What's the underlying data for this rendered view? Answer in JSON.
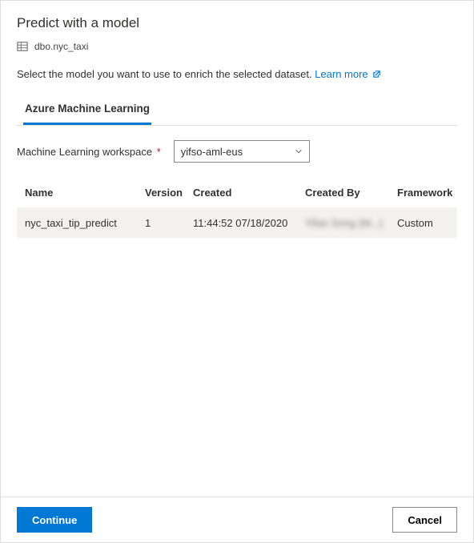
{
  "header": {
    "title": "Predict with a model",
    "dataset_name": "dbo.nyc_taxi"
  },
  "intro": {
    "text": "Select the model you want to use to enrich the selected dataset. ",
    "learn_more_label": "Learn more"
  },
  "tabs": {
    "aml_label": "Azure Machine Learning"
  },
  "field": {
    "label": "Machine Learning workspace",
    "required_mark": "*",
    "selected_value": "yifso-aml-eus"
  },
  "table": {
    "headers": {
      "name": "Name",
      "version": "Version",
      "created": "Created",
      "created_by": "Created By",
      "framework": "Framework"
    },
    "rows": [
      {
        "name": "nyc_taxi_tip_predict",
        "version": "1",
        "created": "11:44:52 07/18/2020",
        "created_by": "Yifan Song (M...)",
        "framework": "Custom"
      }
    ]
  },
  "footer": {
    "continue_label": "Continue",
    "cancel_label": "Cancel"
  }
}
